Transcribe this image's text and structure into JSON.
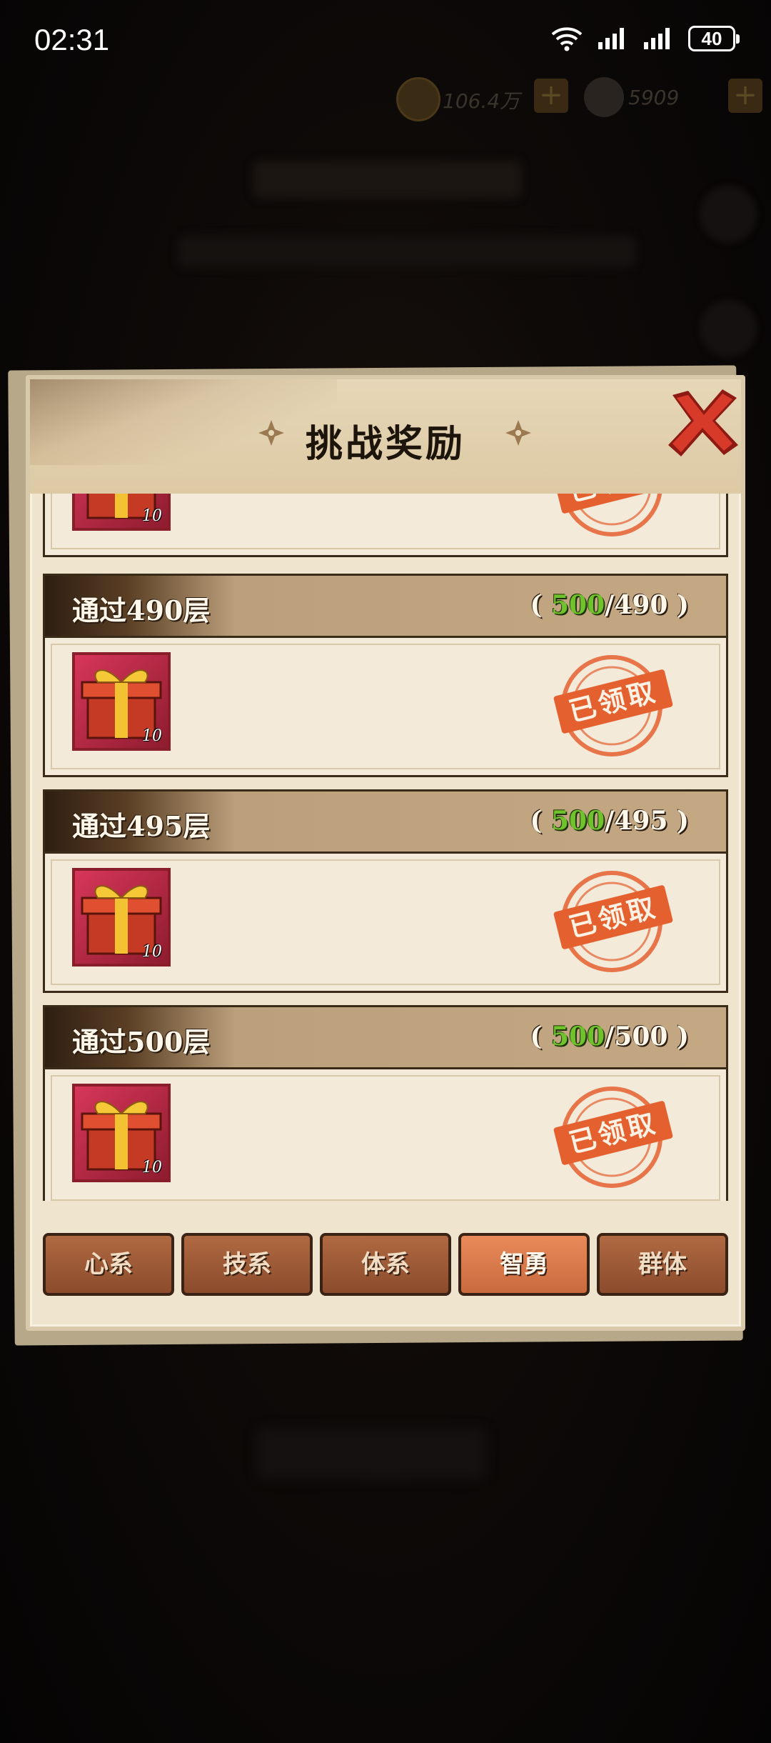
{
  "status_bar": {
    "time": "02:31",
    "battery": "40"
  },
  "background": {
    "coins": "106.4万",
    "gems": "5909"
  },
  "dialog": {
    "title": "挑战奖励",
    "rewards": [
      {
        "title": "",
        "current": "",
        "total": "",
        "item_count": "10",
        "status": "已领取"
      },
      {
        "title": "通过490层",
        "current": "500",
        "total": "/490",
        "item_count": "10",
        "status": "已领取"
      },
      {
        "title": "通过495层",
        "current": "500",
        "total": "/495",
        "item_count": "10",
        "status": "已领取"
      },
      {
        "title": "通过500层",
        "current": "500",
        "total": "/500",
        "item_count": "10",
        "status": "已领取"
      }
    ],
    "tabs": [
      {
        "label": "心系",
        "active": false
      },
      {
        "label": "技系",
        "active": false
      },
      {
        "label": "体系",
        "active": false
      },
      {
        "label": "智勇",
        "active": true
      },
      {
        "label": "群体",
        "active": false
      }
    ]
  },
  "colors": {
    "progress_green": "#6fc22b",
    "stamp_orange": "#e4602f",
    "active_tab": "#e98a5a"
  }
}
